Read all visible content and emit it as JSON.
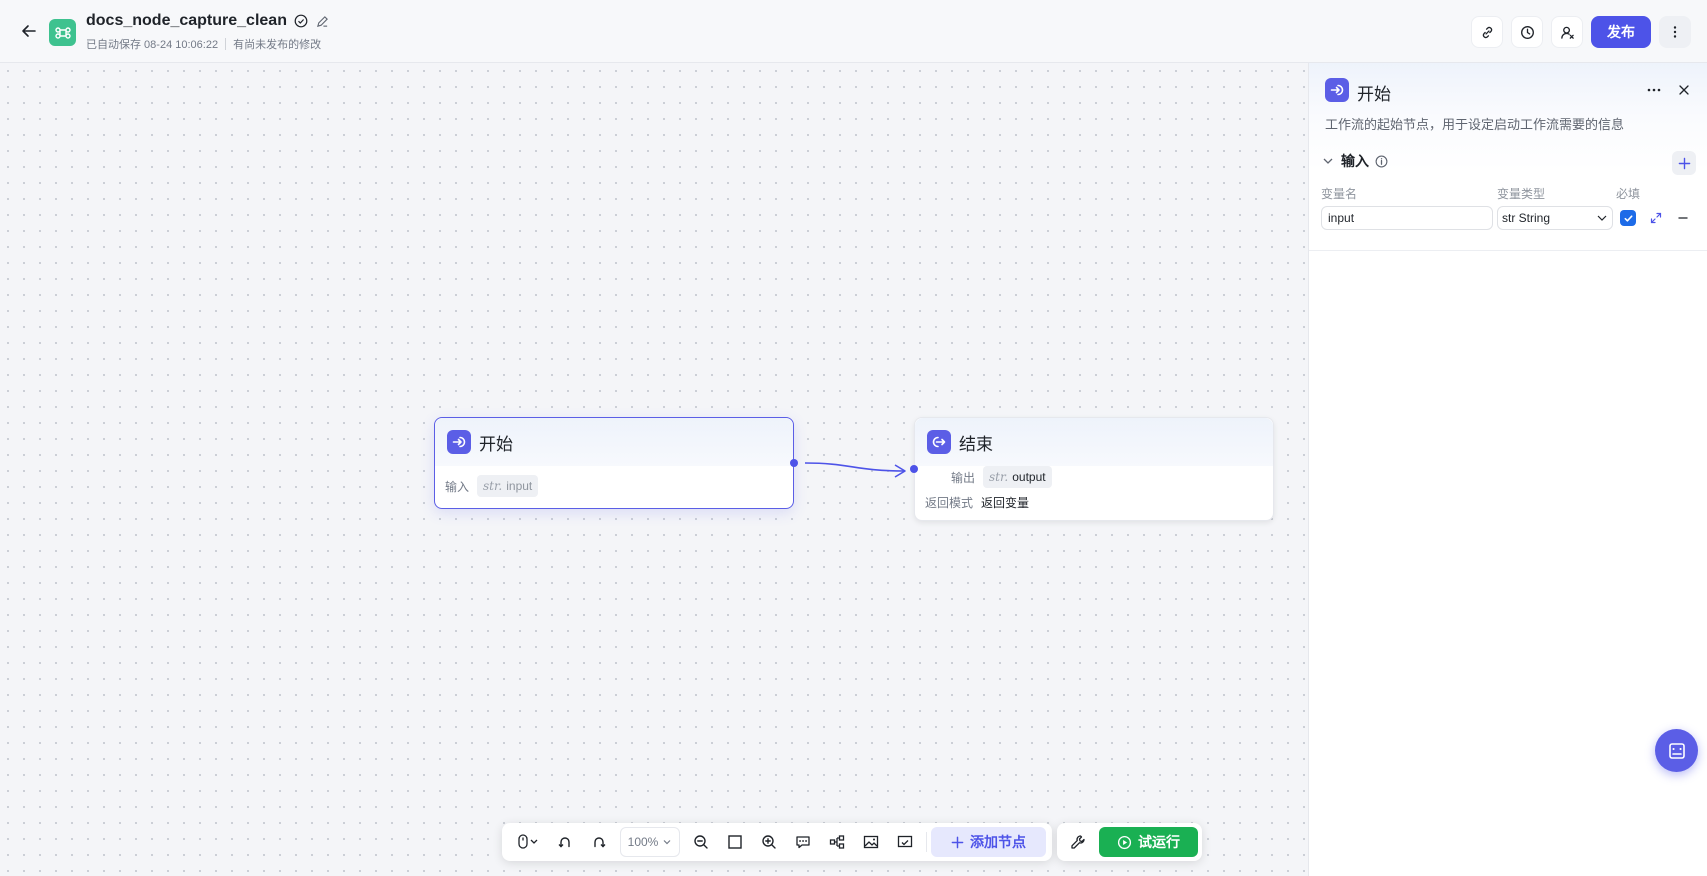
{
  "header": {
    "title": "docs_node_capture_clean",
    "autosave": "已自动保存 08-24 10:06:22",
    "unpublished": "有尚未发布的修改",
    "publish_label": "发布"
  },
  "nodes": {
    "start": {
      "title": "开始",
      "input_label": "输入",
      "var_type": "str.",
      "var_name": "input"
    },
    "end": {
      "title": "结束",
      "output_label": "输出",
      "var_type": "str.",
      "var_name": "output",
      "mode_label": "返回模式",
      "mode_value": "返回变量"
    }
  },
  "toolbar": {
    "zoom": "100%",
    "add_node_label": "添加节点",
    "run_label": "试运行"
  },
  "panel": {
    "title": "开始",
    "description": "工作流的起始节点，用于设定启动工作流需要的信息",
    "section_title": "输入",
    "col_name": "变量名",
    "col_type": "变量类型",
    "col_required": "必填",
    "var_name_value": "input",
    "var_type_value": "str String",
    "required": true
  },
  "colors": {
    "accent": "#4d53e8",
    "run": "#1ab053",
    "logo": "#3ec28f"
  }
}
